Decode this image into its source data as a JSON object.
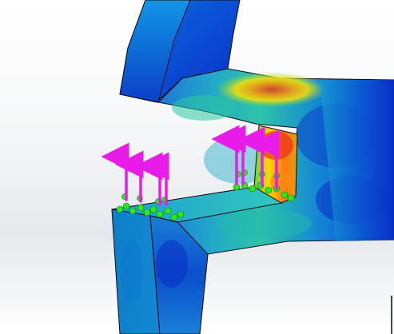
{
  "viewport": {
    "background_top": "#ffffff",
    "background_mid": "#e6e8eb"
  },
  "model": {
    "surface_colors": {
      "low_stress": "#0a2ec8",
      "mid_low": "#0b8fd6",
      "mid": "#19c8c0",
      "mid_high": "#7fe03a",
      "high": "#ffd400",
      "peak": "#e8321c",
      "edge": "#0a0a14"
    }
  },
  "loads": {
    "arrow_color": "#e81ce8",
    "fixture_color": "#2ee81c"
  }
}
